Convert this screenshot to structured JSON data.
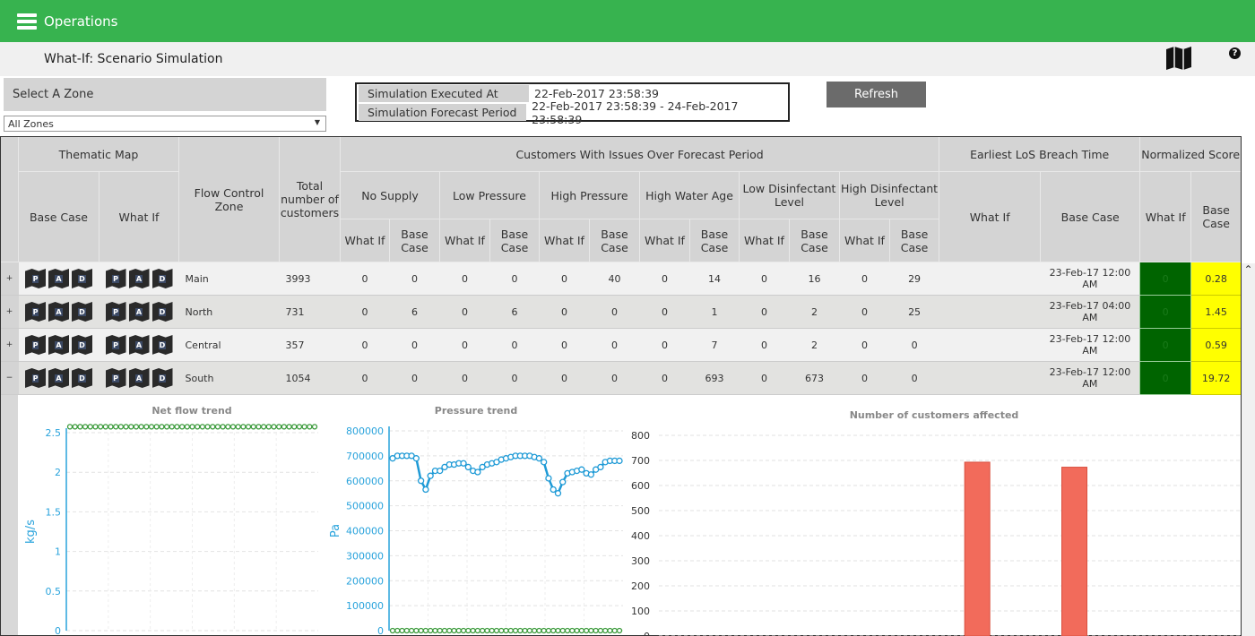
{
  "app": {
    "title": "Operations",
    "page_title": "What-If: Scenario Simulation"
  },
  "zone": {
    "label": "Select A Zone",
    "selected": "All Zones"
  },
  "simulation": {
    "executed_label": "Simulation Executed At",
    "executed_value": "22-Feb-2017 23:58:39",
    "period_label": "Simulation Forecast Period",
    "period_value": "22-Feb-2017 23:58:39 - 24-Feb-2017 23:58:39"
  },
  "refresh_label": "Refresh",
  "table": {
    "h": {
      "thematic": "Thematic Map",
      "base": "Base Case",
      "whatif": "What If",
      "zone": "Flow Control Zone",
      "total": "Total number of customers",
      "issues": "Customers With Issues Over Forecast Period",
      "los": "Earliest LoS Breach Time",
      "score": "Normalized Score",
      "groups": [
        "No Supply",
        "Low Pressure",
        "High Pressure",
        "High Water Age",
        "Low Disinfectant Level",
        "High Disinfectant Level"
      ]
    },
    "map_letters": [
      "P",
      "A",
      "D"
    ],
    "rows": [
      {
        "expander": "+",
        "zone": "Main",
        "total": "3993",
        "values": [
          "0",
          "0",
          "0",
          "0",
          "0",
          "40",
          "0",
          "14",
          "0",
          "16",
          "0",
          "29"
        ],
        "los_whatif": "",
        "los_base": "23-Feb-17 12:00 AM",
        "score_whatif": "0",
        "score_base": "0.28"
      },
      {
        "expander": "+",
        "zone": "North",
        "total": "731",
        "values": [
          "0",
          "6",
          "0",
          "6",
          "0",
          "0",
          "0",
          "1",
          "0",
          "2",
          "0",
          "25"
        ],
        "los_whatif": "",
        "los_base": "23-Feb-17 04:00 AM",
        "score_whatif": "0",
        "score_base": "1.45"
      },
      {
        "expander": "+",
        "zone": "Central",
        "total": "357",
        "values": [
          "0",
          "0",
          "0",
          "0",
          "0",
          "0",
          "0",
          "7",
          "0",
          "2",
          "0",
          "0"
        ],
        "los_whatif": "",
        "los_base": "23-Feb-17 12:00 AM",
        "score_whatif": "0",
        "score_base": "0.59"
      },
      {
        "expander": "−",
        "zone": "South",
        "total": "1054",
        "values": [
          "0",
          "0",
          "0",
          "0",
          "0",
          "0",
          "0",
          "693",
          "0",
          "673",
          "0",
          "0"
        ],
        "los_whatif": "",
        "los_base": "23-Feb-17 12:00 AM",
        "score_whatif": "0",
        "score_base": "19.72"
      }
    ]
  },
  "colors": {
    "header": "#37b34f",
    "score_whatif": "#006400",
    "score_base": "#ffff00",
    "axis": "#29a3dc",
    "flow": "#3a9a3a",
    "bar": "#f26b5b"
  },
  "chart_data": [
    {
      "type": "line",
      "title": "Net flow trend",
      "ylabel": "kg/s",
      "ylim": [
        0,
        2.5
      ],
      "yticks": [
        "0",
        "0.5",
        "1",
        "1.5",
        "2",
        "2.5"
      ],
      "grid": true,
      "series": [
        {
          "values": [
            2.58,
            2.58,
            2.58,
            2.58,
            2.58,
            2.58,
            2.58,
            2.58,
            2.58,
            2.58,
            2.58,
            2.58,
            2.58,
            2.58,
            2.58,
            2.58,
            2.58,
            2.58,
            2.58,
            2.58,
            2.58,
            2.58,
            2.58,
            2.58,
            2.58,
            2.58,
            2.58,
            2.58,
            2.58,
            2.58,
            2.58,
            2.58,
            2.58,
            2.58,
            2.58,
            2.58,
            2.58,
            2.58,
            2.58,
            2.58,
            2.58,
            2.58,
            2.58,
            2.58,
            2.58,
            2.58,
            2.58,
            2.58,
            2.58
          ]
        }
      ]
    },
    {
      "type": "line",
      "title": "Pressure trend",
      "ylabel": "Pa",
      "ylim": [
        0,
        800000
      ],
      "yticks": [
        "0",
        "100000",
        "200000",
        "300000",
        "400000",
        "500000",
        "600000",
        "700000",
        "800000"
      ],
      "grid": true,
      "series": [
        {
          "color": "#1e9ad6",
          "values": [
            690000,
            700000,
            700000,
            700000,
            700000,
            690000,
            600000,
            565000,
            620000,
            640000,
            640000,
            655000,
            665000,
            665000,
            670000,
            670000,
            655000,
            640000,
            635000,
            655000,
            665000,
            670000,
            675000,
            685000,
            690000,
            695000,
            700000,
            700000,
            700000,
            700000,
            695000,
            690000,
            675000,
            610000,
            565000,
            550000,
            595000,
            630000,
            635000,
            640000,
            645000,
            630000,
            625000,
            645000,
            655000,
            675000,
            680000,
            680000,
            680000
          ]
        },
        {
          "color": "#3a9a3a",
          "values": [
            0,
            0,
            0,
            0,
            0,
            0,
            0,
            0,
            0,
            0,
            0,
            0,
            0,
            0,
            0,
            0,
            0,
            0,
            0,
            0,
            0,
            0,
            0,
            0,
            0,
            0,
            0,
            0,
            0,
            0,
            0,
            0,
            0,
            0,
            0,
            0,
            0,
            0,
            0,
            0,
            0,
            0,
            0,
            0,
            0,
            0,
            0,
            0,
            0
          ]
        }
      ]
    },
    {
      "type": "bar",
      "title": "Number of customers affected",
      "ylim": [
        0,
        800
      ],
      "yticks": [
        "0",
        "100",
        "200",
        "300",
        "400",
        "500",
        "600",
        "700",
        "800"
      ],
      "grid": true,
      "values": [
        0,
        0,
        0,
        693,
        673,
        0
      ]
    }
  ]
}
